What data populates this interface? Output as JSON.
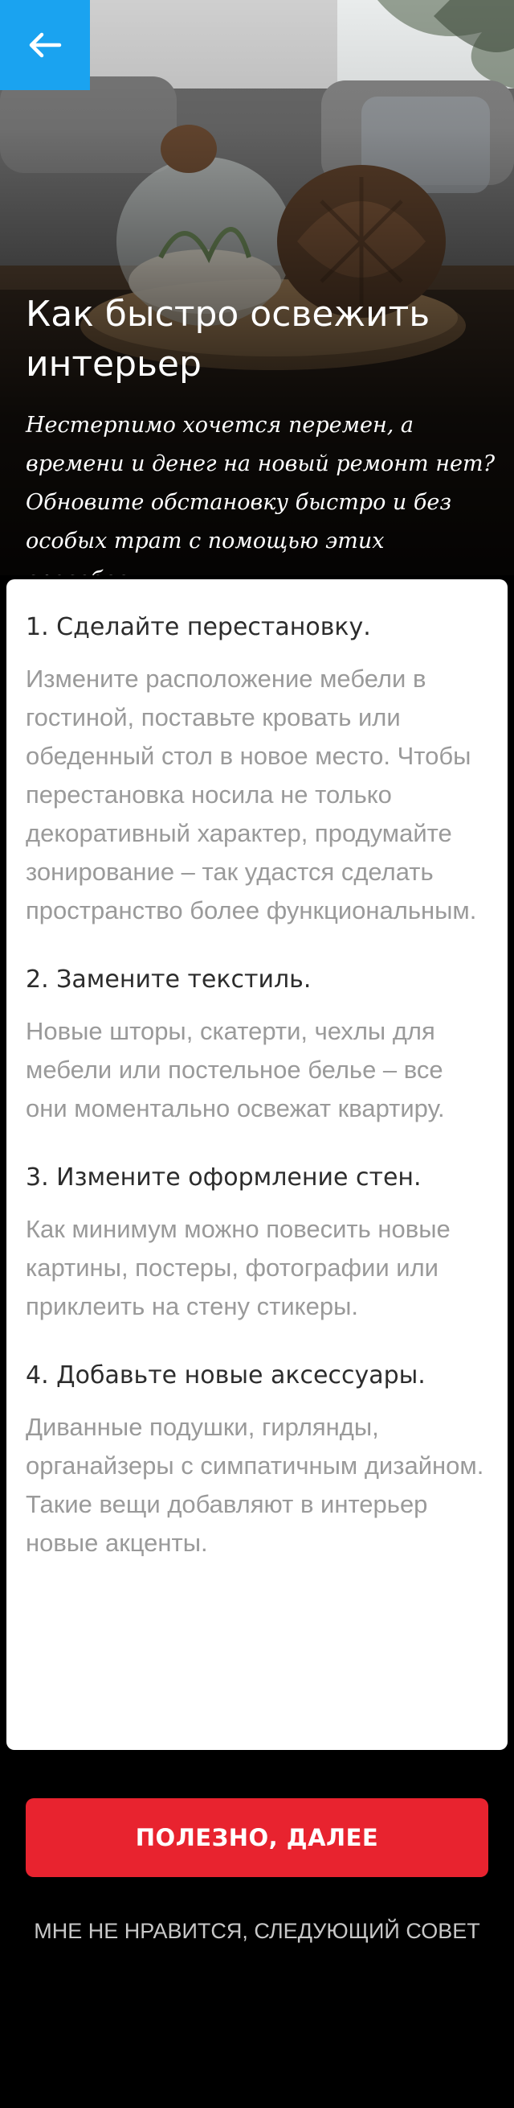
{
  "header": {
    "back_icon": "arrow-left-icon",
    "back_button_color": "#1aa3f0"
  },
  "hero": {
    "title": "Как быстро освежить интерьер",
    "lead": "Нестерпимо хочется перемен, а времени и денег на новый ремонт нет? Обновите обстановку быстро и без особых трат с помощью этих способов."
  },
  "tips": [
    {
      "title": "1. Сделайте перестановку.",
      "text": "Измените расположение мебели в гостиной, поставьте кровать или обеденный стол в новое место. Чтобы перестановка носила не только декоративный характер, продумайте зонирование – так удастся сделать пространство более функциональным."
    },
    {
      "title": "2. Замените текстиль.",
      "text": "Новые шторы, скатерти, чехлы для мебели или постельное белье – все они моментально освежат квартиру."
    },
    {
      "title": "3. Измените оформление стен.",
      "text": "Как минимум можно повесить новые картины, постеры, фотографии или приклеить на стену стикеры."
    },
    {
      "title": "4. Добавьте новые аксессуары.",
      "text": "Диванные подушки, гирлянды, органайзеры с симпатичным дизайном. Такие вещи добавляют в интерьер новые акценты."
    }
  ],
  "actions": {
    "primary_label": "ПОЛЕЗНО, ДАЛЕЕ",
    "primary_color": "#e8232f",
    "secondary_label": "МНЕ НЕ НРАВИТСЯ, СЛЕДУЮЩИЙ СОВЕТ"
  }
}
